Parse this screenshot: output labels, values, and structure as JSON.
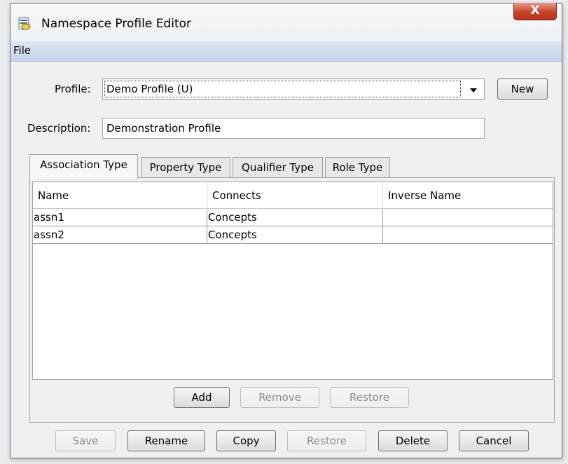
{
  "window": {
    "title": "Namespace Profile Editor",
    "close_label": "X"
  },
  "menu": {
    "file": "File"
  },
  "profile": {
    "label": "Profile:",
    "selected": "Demo Profile (U)",
    "new_button": "New"
  },
  "description": {
    "label": "Description:",
    "value": "Demonstration Profile"
  },
  "tabs": [
    {
      "label": "Association Type",
      "active": true
    },
    {
      "label": "Property Type"
    },
    {
      "label": "Qualifier Type"
    },
    {
      "label": "Role Type"
    }
  ],
  "table": {
    "columns": [
      "Name",
      "Connects",
      "Inverse Name"
    ],
    "rows": [
      [
        "assn1",
        "Concepts",
        ""
      ],
      [
        "assn2",
        "Concepts",
        ""
      ]
    ]
  },
  "table_buttons": {
    "add": "Add",
    "remove": "Remove",
    "restore": "Restore"
  },
  "footer_buttons": {
    "save": "Save",
    "rename": "Rename",
    "copy": "Copy",
    "restore": "Restore",
    "delete": "Delete",
    "cancel": "Cancel"
  },
  "colors": {
    "close_button": "#c7442b",
    "menubar": "#c6d5eb"
  }
}
